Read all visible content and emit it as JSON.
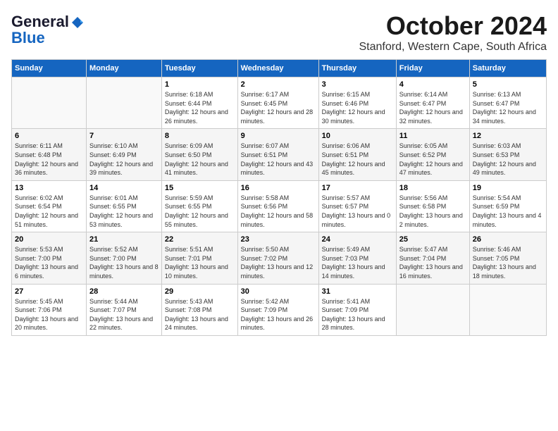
{
  "logo": {
    "general": "General",
    "blue": "Blue"
  },
  "header": {
    "month_title": "October 2024",
    "location": "Stanford, Western Cape, South Africa"
  },
  "weekdays": [
    "Sunday",
    "Monday",
    "Tuesday",
    "Wednesday",
    "Thursday",
    "Friday",
    "Saturday"
  ],
  "weeks": [
    [
      {
        "day": "",
        "sunrise": "",
        "sunset": "",
        "daylight": ""
      },
      {
        "day": "",
        "sunrise": "",
        "sunset": "",
        "daylight": ""
      },
      {
        "day": "1",
        "sunrise": "Sunrise: 6:18 AM",
        "sunset": "Sunset: 6:44 PM",
        "daylight": "Daylight: 12 hours and 26 minutes."
      },
      {
        "day": "2",
        "sunrise": "Sunrise: 6:17 AM",
        "sunset": "Sunset: 6:45 PM",
        "daylight": "Daylight: 12 hours and 28 minutes."
      },
      {
        "day": "3",
        "sunrise": "Sunrise: 6:15 AM",
        "sunset": "Sunset: 6:46 PM",
        "daylight": "Daylight: 12 hours and 30 minutes."
      },
      {
        "day": "4",
        "sunrise": "Sunrise: 6:14 AM",
        "sunset": "Sunset: 6:47 PM",
        "daylight": "Daylight: 12 hours and 32 minutes."
      },
      {
        "day": "5",
        "sunrise": "Sunrise: 6:13 AM",
        "sunset": "Sunset: 6:47 PM",
        "daylight": "Daylight: 12 hours and 34 minutes."
      }
    ],
    [
      {
        "day": "6",
        "sunrise": "Sunrise: 6:11 AM",
        "sunset": "Sunset: 6:48 PM",
        "daylight": "Daylight: 12 hours and 36 minutes."
      },
      {
        "day": "7",
        "sunrise": "Sunrise: 6:10 AM",
        "sunset": "Sunset: 6:49 PM",
        "daylight": "Daylight: 12 hours and 39 minutes."
      },
      {
        "day": "8",
        "sunrise": "Sunrise: 6:09 AM",
        "sunset": "Sunset: 6:50 PM",
        "daylight": "Daylight: 12 hours and 41 minutes."
      },
      {
        "day": "9",
        "sunrise": "Sunrise: 6:07 AM",
        "sunset": "Sunset: 6:51 PM",
        "daylight": "Daylight: 12 hours and 43 minutes."
      },
      {
        "day": "10",
        "sunrise": "Sunrise: 6:06 AM",
        "sunset": "Sunset: 6:51 PM",
        "daylight": "Daylight: 12 hours and 45 minutes."
      },
      {
        "day": "11",
        "sunrise": "Sunrise: 6:05 AM",
        "sunset": "Sunset: 6:52 PM",
        "daylight": "Daylight: 12 hours and 47 minutes."
      },
      {
        "day": "12",
        "sunrise": "Sunrise: 6:03 AM",
        "sunset": "Sunset: 6:53 PM",
        "daylight": "Daylight: 12 hours and 49 minutes."
      }
    ],
    [
      {
        "day": "13",
        "sunrise": "Sunrise: 6:02 AM",
        "sunset": "Sunset: 6:54 PM",
        "daylight": "Daylight: 12 hours and 51 minutes."
      },
      {
        "day": "14",
        "sunrise": "Sunrise: 6:01 AM",
        "sunset": "Sunset: 6:55 PM",
        "daylight": "Daylight: 12 hours and 53 minutes."
      },
      {
        "day": "15",
        "sunrise": "Sunrise: 5:59 AM",
        "sunset": "Sunset: 6:55 PM",
        "daylight": "Daylight: 12 hours and 55 minutes."
      },
      {
        "day": "16",
        "sunrise": "Sunrise: 5:58 AM",
        "sunset": "Sunset: 6:56 PM",
        "daylight": "Daylight: 12 hours and 58 minutes."
      },
      {
        "day": "17",
        "sunrise": "Sunrise: 5:57 AM",
        "sunset": "Sunset: 6:57 PM",
        "daylight": "Daylight: 13 hours and 0 minutes."
      },
      {
        "day": "18",
        "sunrise": "Sunrise: 5:56 AM",
        "sunset": "Sunset: 6:58 PM",
        "daylight": "Daylight: 13 hours and 2 minutes."
      },
      {
        "day": "19",
        "sunrise": "Sunrise: 5:54 AM",
        "sunset": "Sunset: 6:59 PM",
        "daylight": "Daylight: 13 hours and 4 minutes."
      }
    ],
    [
      {
        "day": "20",
        "sunrise": "Sunrise: 5:53 AM",
        "sunset": "Sunset: 7:00 PM",
        "daylight": "Daylight: 13 hours and 6 minutes."
      },
      {
        "day": "21",
        "sunrise": "Sunrise: 5:52 AM",
        "sunset": "Sunset: 7:00 PM",
        "daylight": "Daylight: 13 hours and 8 minutes."
      },
      {
        "day": "22",
        "sunrise": "Sunrise: 5:51 AM",
        "sunset": "Sunset: 7:01 PM",
        "daylight": "Daylight: 13 hours and 10 minutes."
      },
      {
        "day": "23",
        "sunrise": "Sunrise: 5:50 AM",
        "sunset": "Sunset: 7:02 PM",
        "daylight": "Daylight: 13 hours and 12 minutes."
      },
      {
        "day": "24",
        "sunrise": "Sunrise: 5:49 AM",
        "sunset": "Sunset: 7:03 PM",
        "daylight": "Daylight: 13 hours and 14 minutes."
      },
      {
        "day": "25",
        "sunrise": "Sunrise: 5:47 AM",
        "sunset": "Sunset: 7:04 PM",
        "daylight": "Daylight: 13 hours and 16 minutes."
      },
      {
        "day": "26",
        "sunrise": "Sunrise: 5:46 AM",
        "sunset": "Sunset: 7:05 PM",
        "daylight": "Daylight: 13 hours and 18 minutes."
      }
    ],
    [
      {
        "day": "27",
        "sunrise": "Sunrise: 5:45 AM",
        "sunset": "Sunset: 7:06 PM",
        "daylight": "Daylight: 13 hours and 20 minutes."
      },
      {
        "day": "28",
        "sunrise": "Sunrise: 5:44 AM",
        "sunset": "Sunset: 7:07 PM",
        "daylight": "Daylight: 13 hours and 22 minutes."
      },
      {
        "day": "29",
        "sunrise": "Sunrise: 5:43 AM",
        "sunset": "Sunset: 7:08 PM",
        "daylight": "Daylight: 13 hours and 24 minutes."
      },
      {
        "day": "30",
        "sunrise": "Sunrise: 5:42 AM",
        "sunset": "Sunset: 7:09 PM",
        "daylight": "Daylight: 13 hours and 26 minutes."
      },
      {
        "day": "31",
        "sunrise": "Sunrise: 5:41 AM",
        "sunset": "Sunset: 7:09 PM",
        "daylight": "Daylight: 13 hours and 28 minutes."
      },
      {
        "day": "",
        "sunrise": "",
        "sunset": "",
        "daylight": ""
      },
      {
        "day": "",
        "sunrise": "",
        "sunset": "",
        "daylight": ""
      }
    ]
  ]
}
